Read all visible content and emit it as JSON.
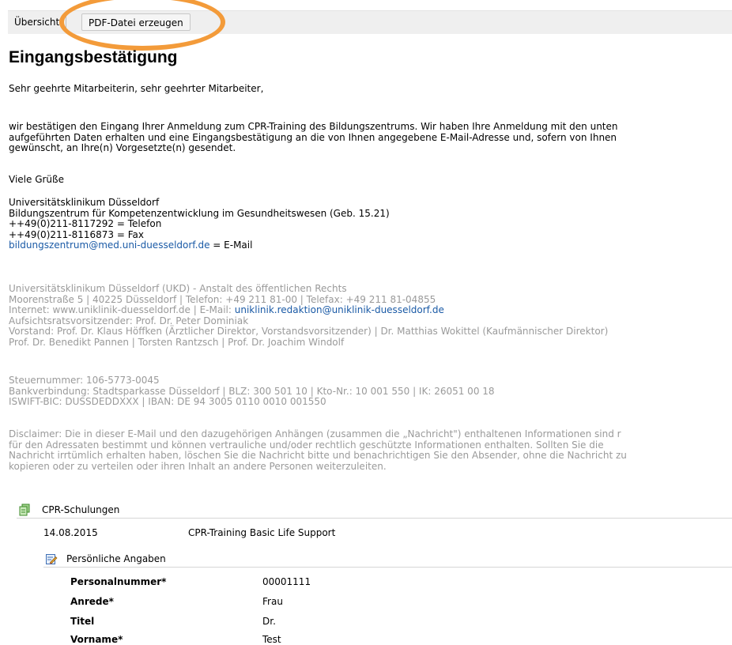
{
  "toolbar": {
    "overview_label": "Übersicht",
    "pdf_label": "PDF-Datei erzeugen"
  },
  "page_title": "Eingangsbestätigung",
  "greeting": "Sehr geehrte Mitarbeiterin, sehr geehrter Mitarbeiter,",
  "body_lines": [
    "wir bestätigen den Eingang Ihrer Anmeldung zum CPR-Training des Bildungszentrums. Wir haben Ihre Anmeldung mit den unten",
    "aufgeführten Daten erhalten und eine Eingangsbestätigung an die von Ihnen angegebene E-Mail-Adresse und, sofern von Ihnen",
    "gewünscht, an Ihre(n) Vorgesetzte(n) gesendet."
  ],
  "closing": "Viele Grüße",
  "signature": {
    "org": "Universitätsklinikum Düsseldorf",
    "dept": "Bildungszentrum für Kompetenzentwicklung im Gesundheitswesen (Geb. 15.21)",
    "phone": "++49(0)211-8117292 = Telefon",
    "fax": "++49(0)211-8116873 = Fax",
    "email_link": "bildungszentrum@med.uni-duesseldorf.de",
    "email_suffix": " = E-Mail"
  },
  "footer": {
    "line1": "Universitätsklinikum Düsseldorf (UKD) - Anstalt des öffentlichen Rechts",
    "line2": "Moorenstraße 5 | 40225 Düsseldorf | Telefon: +49 211 81-00 | Telefax: +49 211 81-04855",
    "line3_prefix": "Internet: www.uniklinik-duesseldorf.de | E-Mail: ",
    "line3_link": "uniklinik.redaktion@uniklinik-duesseldorf.de",
    "line4": "Aufsichtsratsvorsitzender: Prof. Dr. Peter Dominiak",
    "line5": "Vorstand: Prof. Dr. Klaus Höffken (Ärztlicher Direktor, Vorstandsvorsitzender) | Dr. Matthias Wokittel (Kaufmännischer Direktor)",
    "line6": "Prof. Dr. Benedikt Pannen | Torsten Rantzsch | Prof. Dr. Joachim Windolf",
    "line7": "Steuernummer: 106-5773-0045",
    "line8": "Bankverbindung: Stadtsparkasse Düsseldorf | BLZ: 300 501 10 | Kto-Nr.: 10 001 550 | IK: 26051 00 18",
    "line9": "ISWIFT-BIC: DUSSDEDDXXX | IBAN: DE 94 3005 0110 0010 001550",
    "disclaimer": [
      "Disclaimer: Die in dieser E-Mail und den dazugehörigen Anhängen (zusammen die „Nachricht\") enthaltenen Informationen sind r",
      "für den Adressaten bestimmt und können vertrauliche und/oder rechtlich geschützte Informationen enthalten. Sollten Sie die",
      "Nachricht irrtümlich erhalten haben, löschen Sie die Nachricht bitte und benachrichtigen Sie den Absender, ohne die Nachricht zu",
      "kopieren oder zu verteilen oder ihren Inhalt an andere Personen weiterzuleiten."
    ]
  },
  "courses": {
    "section_label": "CPR-Schulungen",
    "date": "14.08.2015",
    "title": "CPR-Training Basic Life Support"
  },
  "personal": {
    "section_label": "Persönliche Angaben",
    "fields": [
      {
        "label": "Personalnummer*",
        "value": "00001111"
      },
      {
        "label": "Anrede*",
        "value": "Frau"
      },
      {
        "label": "Titel",
        "value": "Dr."
      },
      {
        "label": "Vorname*",
        "value": "Test"
      }
    ]
  },
  "colors": {
    "highlight": "#f39b3a",
    "link": "#1a5aa6",
    "muted_text": "#9a9a9a"
  }
}
